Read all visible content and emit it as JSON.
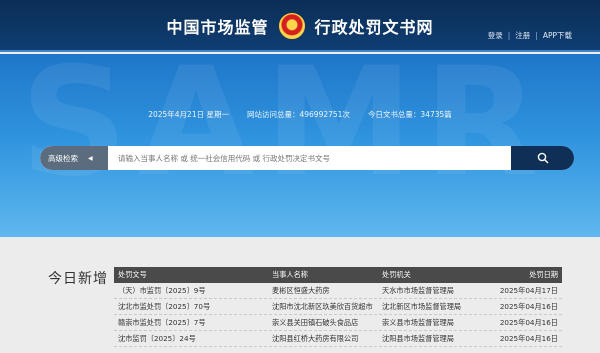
{
  "header": {
    "title_left": "中国市场监管",
    "title_right": "行政处罚文书网",
    "links": [
      "登录",
      "注册",
      "APP下载"
    ],
    "separator": "|"
  },
  "banner": {
    "watermark": "SAMR",
    "date": "2025年4月21日 星期一",
    "visits": "网站访问总量：496992751次",
    "today_docs": "今日文书总量：34735篇"
  },
  "search": {
    "mode_label": "高级检索",
    "placeholder": "请输入当事人名称 或 统一社会信用代码 或 行政处罚决定书文号",
    "button_icon": "search-icon"
  },
  "today": {
    "title": "今日新增",
    "columns": [
      "处罚文号",
      "当事人名称",
      "处罚机关",
      "处罚日期"
    ],
    "rows": [
      [
        "（天）市监罚〔2025〕9号",
        "麦彬区恒盛大药房",
        "天水市市场监督管理局",
        "2025年04月17日"
      ],
      [
        "沈北市监处罚〔2025〕70号",
        "沈阳市沈北新区玖美欣百货超市",
        "沈北新区市场监督管理局",
        "2025年04月16日"
      ],
      [
        "赣崇市监处罚〔2025〕7号",
        "崇义县关田镇石破头食品店",
        "崇义县市场监督管理局",
        "2025年04月16日"
      ],
      [
        "沈市监罚〔2025〕24号",
        "沈阳县红桥大药房有限公司",
        "沈阳县市场监督管理局",
        "2025年04月16日"
      ]
    ]
  },
  "colors": {
    "header_bg": "#0f3d72",
    "banner": "#2f93de",
    "search_button": "#0f2f57",
    "table_head": "#4a4a4a"
  }
}
